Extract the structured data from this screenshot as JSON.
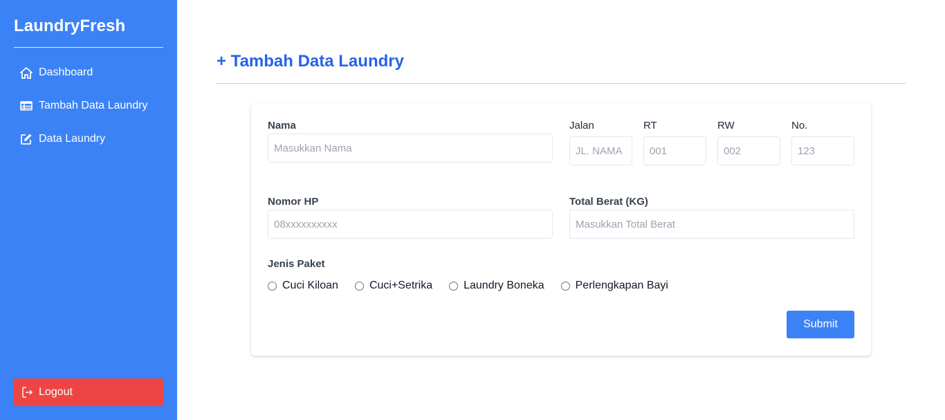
{
  "sidebar": {
    "brand": "LaundryFresh",
    "items": [
      {
        "label": "Dashboard",
        "icon": "home-icon"
      },
      {
        "label": "Tambah Data Laundry",
        "icon": "table-icon"
      },
      {
        "label": "Data Laundry",
        "icon": "edit-icon"
      }
    ],
    "logout": {
      "label": "Logout",
      "icon": "logout-icon"
    }
  },
  "page": {
    "title": "+ Tambah Data Laundry"
  },
  "form": {
    "nama": {
      "label": "Nama",
      "placeholder": "Masukkan Nama",
      "value": ""
    },
    "jalan": {
      "label": "Jalan",
      "placeholder": "JL. NAMA",
      "value": ""
    },
    "rt": {
      "label": "RT",
      "placeholder": "001",
      "value": ""
    },
    "rw": {
      "label": "RW",
      "placeholder": "002",
      "value": ""
    },
    "no": {
      "label": "No.",
      "placeholder": "123",
      "value": ""
    },
    "nomor_hp": {
      "label": "Nomor HP",
      "placeholder": "08xxxxxxxxxx",
      "value": ""
    },
    "total_berat": {
      "label": "Total Berat (KG)",
      "placeholder": "Masukkan Total Berat",
      "value": ""
    },
    "jenis_paket": {
      "label": "Jenis Paket",
      "options": [
        "Cuci Kiloan",
        "Cuci+Setrika",
        "Laundry Boneka",
        "Perlengkapan Bayi"
      ]
    },
    "submit_label": "Submit"
  },
  "colors": {
    "sidebar_bg": "#3b82f6",
    "accent": "#2563eb",
    "logout_bg": "#ef4444",
    "submit_bg": "#3b82f6"
  }
}
